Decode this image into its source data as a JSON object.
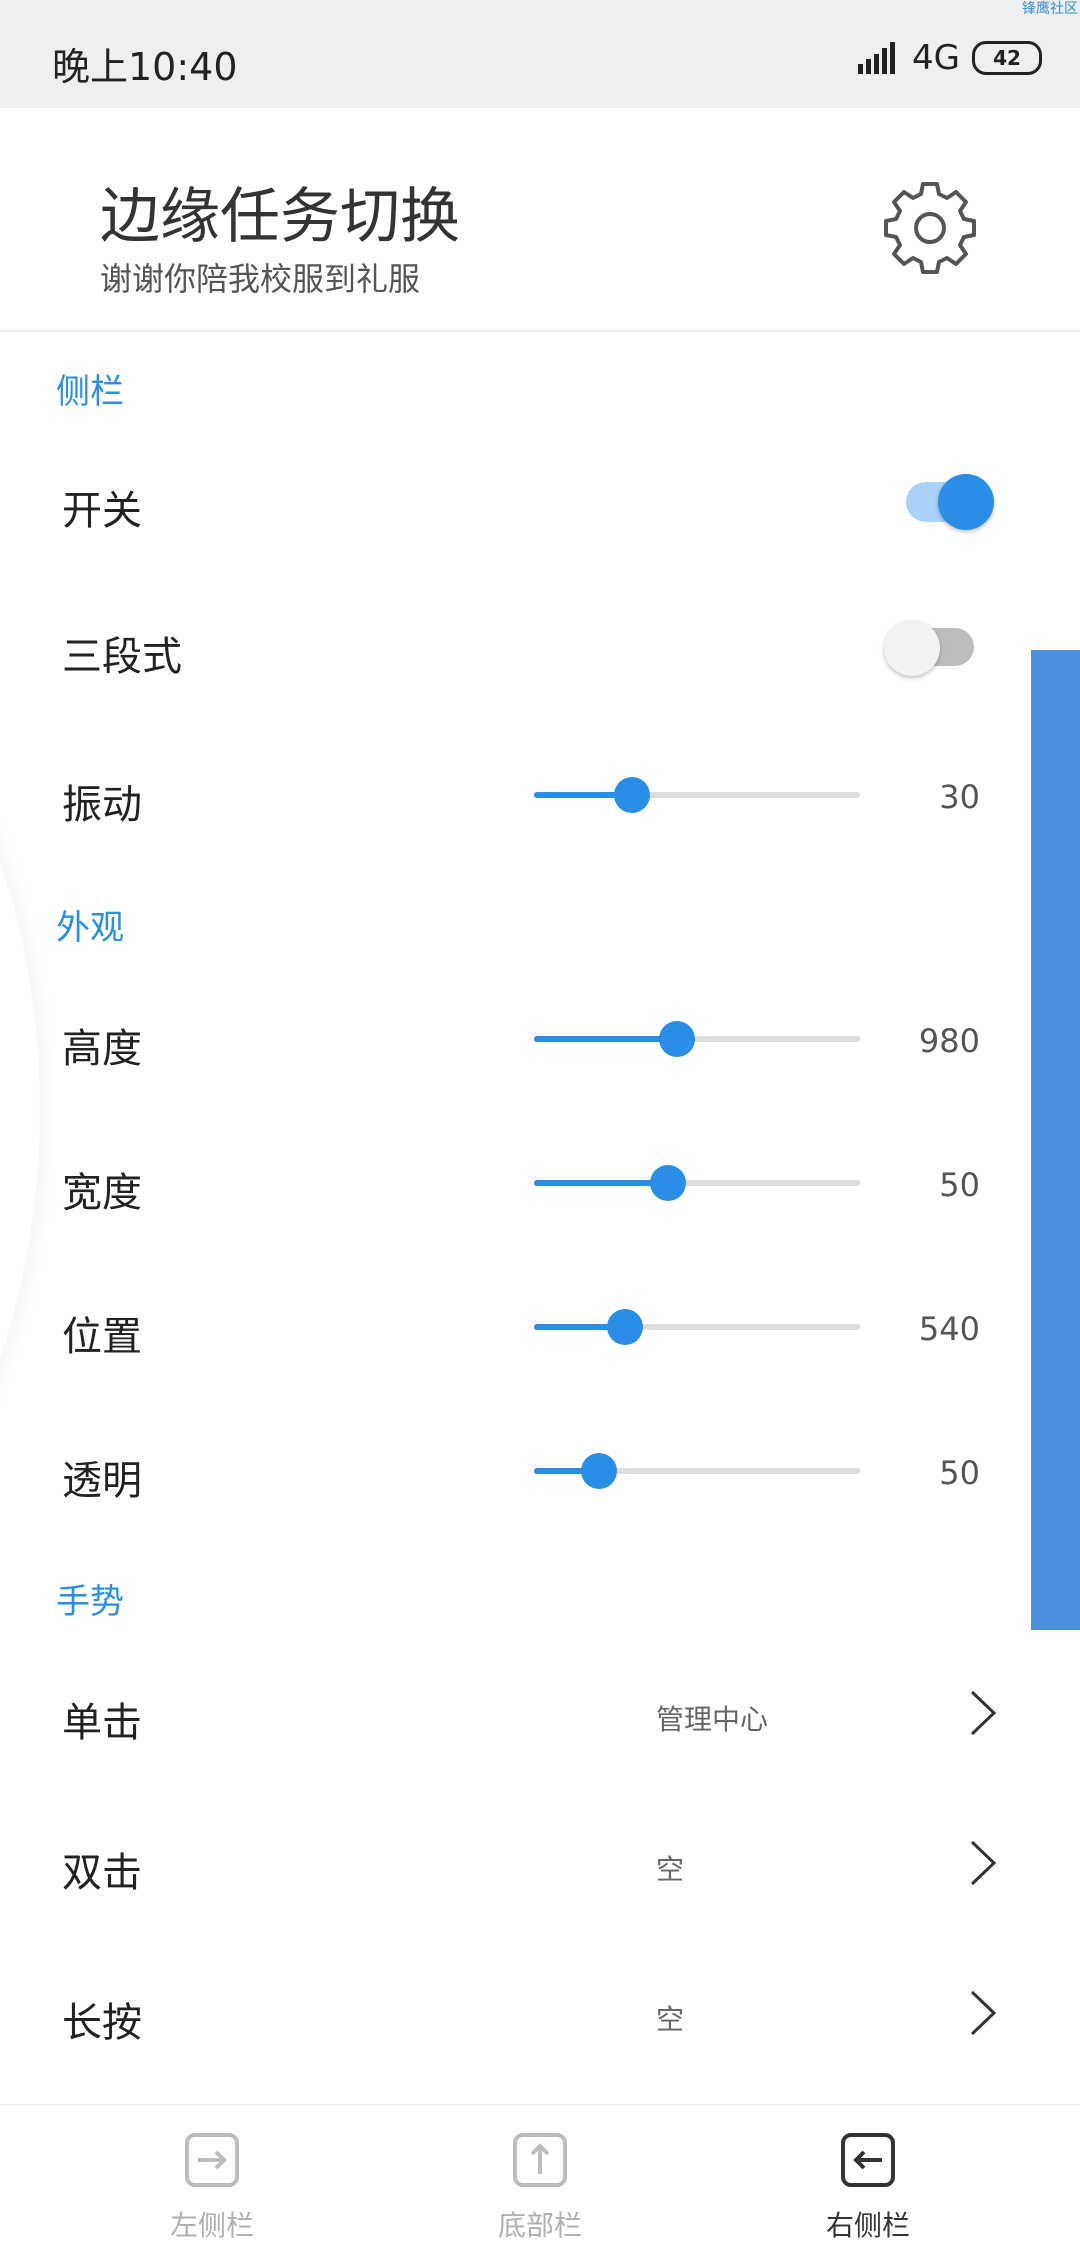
{
  "status_bar": {
    "time": "晚上10:40",
    "network": "4G",
    "battery": "42",
    "watermark": "锋鹰社区"
  },
  "header": {
    "title": "边缘任务切换",
    "subtitle": "谢谢你陪我校服到礼服",
    "settings_icon": "gear-icon"
  },
  "sections": {
    "sidebar": {
      "title": "侧栏",
      "switch_label": "开关",
      "switch_on": true,
      "three_stage_label": "三段式",
      "three_stage_on": false,
      "vibration_label": "振动",
      "vibration_value": "30",
      "vibration_fraction": 0.3
    },
    "appearance": {
      "title": "外观",
      "height_label": "高度",
      "height_value": "980",
      "height_fraction": 0.44,
      "width_label": "宽度",
      "width_value": "50",
      "width_fraction": 0.41,
      "position_label": "位置",
      "position_value": "540",
      "position_fraction": 0.28,
      "opacity_label": "透明",
      "opacity_value": "50",
      "opacity_fraction": 0.2
    },
    "gestures": {
      "title": "手势",
      "single_label": "单击",
      "single_value": "管理中心",
      "double_label": "双击",
      "double_value": "空",
      "long_label": "长按",
      "long_value": "空"
    }
  },
  "bottom_nav": {
    "left": "左侧栏",
    "bottom": "底部栏",
    "right": "右侧栏",
    "active": "right"
  },
  "colors": {
    "accent": "#2b8ee6",
    "side_bar": "#4a90dc"
  }
}
